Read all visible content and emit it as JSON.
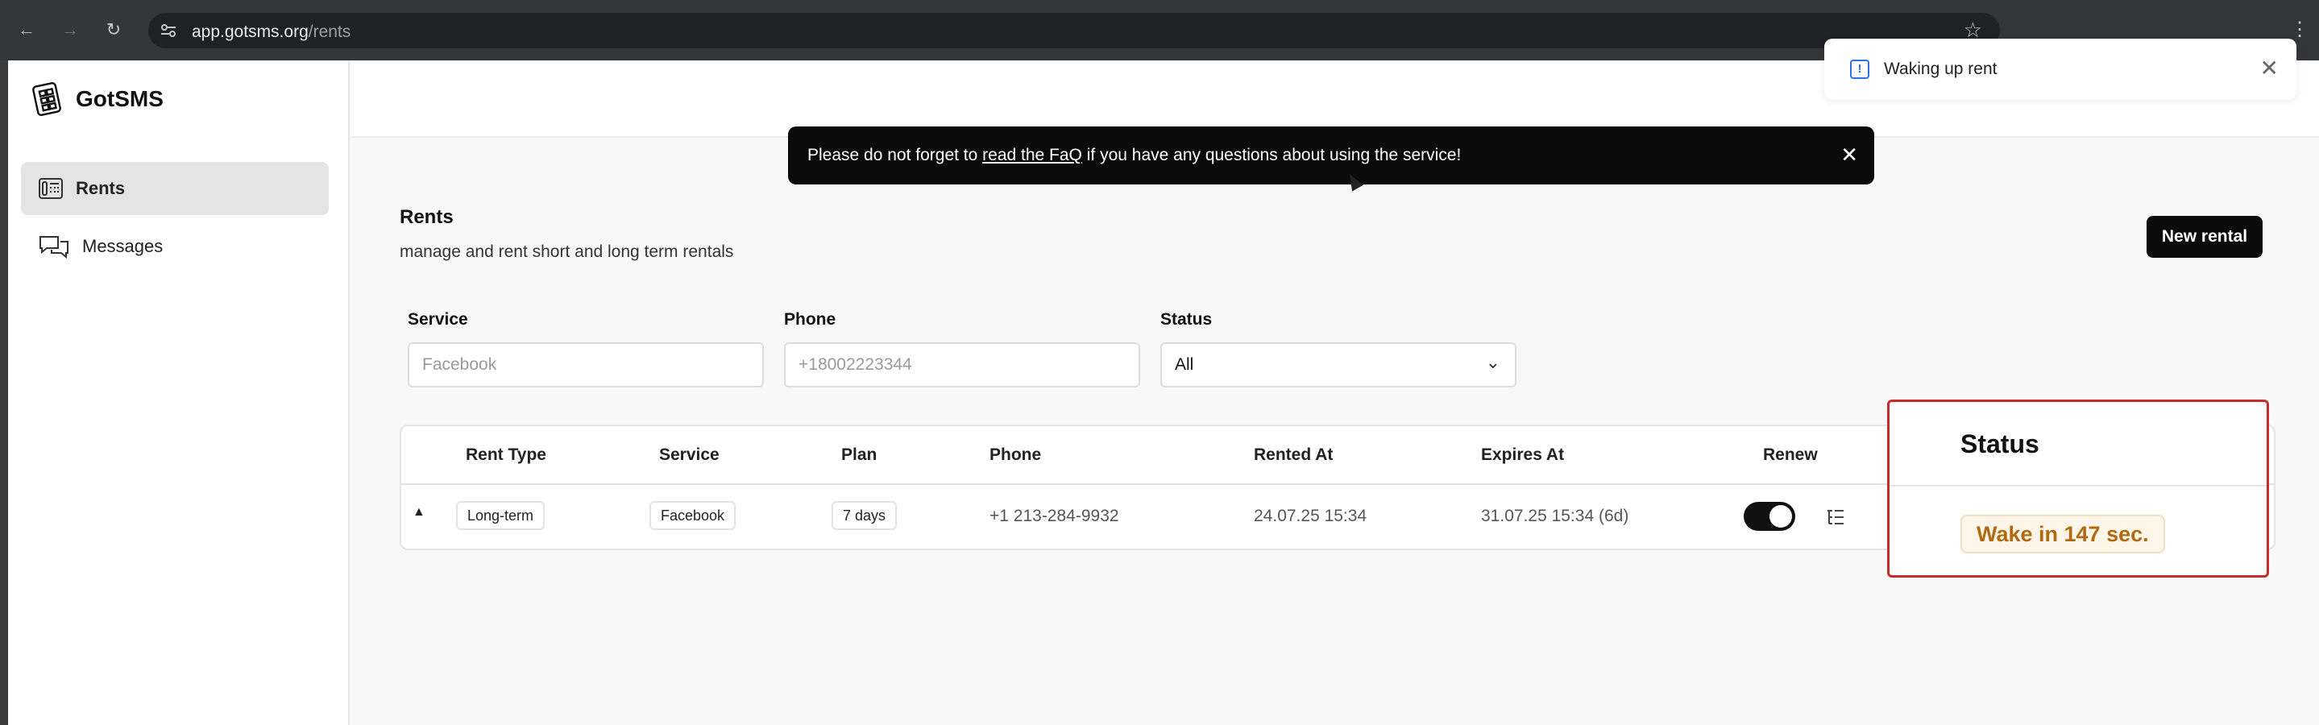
{
  "browser": {
    "url_host": "app.gotsms.org",
    "url_path": "/rents"
  },
  "sidebar": {
    "brand": "GotSMS",
    "items": [
      {
        "label": "Rents",
        "icon": "rents-icon",
        "active": true
      },
      {
        "label": "Messages",
        "icon": "messages-icon",
        "active": false
      }
    ]
  },
  "toast": {
    "text": "Waking up rent"
  },
  "banner": {
    "text_before": "Please do not forget to ",
    "link_text": "read the FaQ",
    "text_after": " if you have any questions about using the service!"
  },
  "header": {
    "title": "Rents",
    "subtitle": "manage and rent short and long term rentals",
    "new_button": "New rental"
  },
  "filters": {
    "service_label": "Service",
    "service_placeholder": "Facebook",
    "phone_label": "Phone",
    "phone_placeholder": "+18002223344",
    "status_label": "Status",
    "status_value": "All"
  },
  "table": {
    "columns": [
      "Rent Type",
      "Service",
      "Plan",
      "Phone",
      "Rented At",
      "Expires At",
      "Renew"
    ],
    "rows": [
      {
        "rent_type": "Long-term",
        "service": "Facebook",
        "plan": "7 days",
        "phone": "+1 213-284-9932",
        "rented_at": "24.07.25 15:34",
        "expires_at": "31.07.25 15:34 (6d)",
        "renew": true
      }
    ]
  },
  "status_column": {
    "header": "Status",
    "badge": "Wake in 147 sec."
  },
  "colors": {
    "highlight_border": "#c72c2c",
    "badge_text": "#b06a12",
    "badge_bg": "#fdf5e8"
  }
}
